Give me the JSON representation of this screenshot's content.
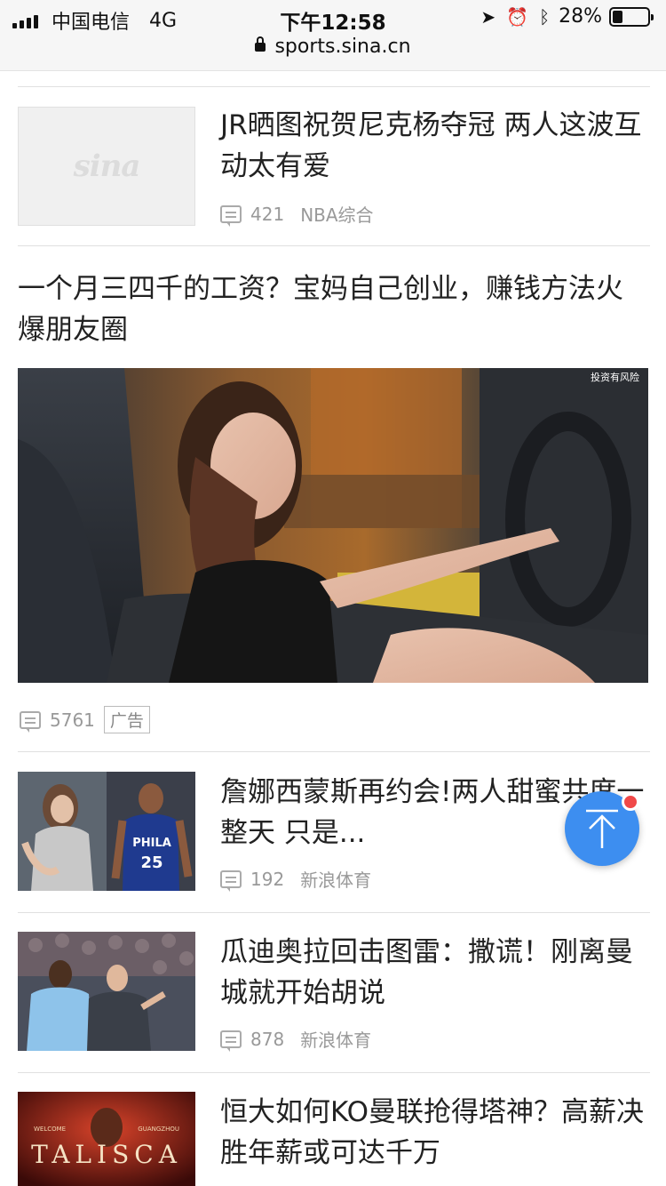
{
  "status_bar": {
    "carrier": "中国电信",
    "network": "4G",
    "time": "下午12:58",
    "battery_text": "28%",
    "battery_level": 0.28
  },
  "url_bar": {
    "domain": "sports.sina.cn"
  },
  "feed": {
    "items": [
      {
        "title": "JR晒图祝贺尼克杨夺冠 两人这波互动太有爱",
        "comments": "421",
        "source": "NBA综合",
        "thumb_logo": "sina"
      },
      {
        "title": "一个月三四千的工资？宝妈自己创业，赚钱方法火爆朋友圈",
        "comments": "5761",
        "badge": "广告",
        "image_caption": "投资有风险"
      },
      {
        "title": "詹娜西蒙斯再约会!两人甜蜜共度一整天 只是...",
        "comments": "192",
        "source": "新浪体育",
        "jersey_text": "PHILA",
        "jersey_number": "25"
      },
      {
        "title": "瓜迪奥拉回击图雷：撒谎！刚离曼城就开始胡说",
        "comments": "878",
        "source": "新浪体育"
      },
      {
        "title": "恒大如何KO曼联抢得塔神？高薪决胜年薪或可达千万",
        "thumb_text_top_left": "WELCOME",
        "thumb_text_top_right": "GUANGZHOU",
        "thumb_text_main": "TALISCA"
      }
    ]
  },
  "colors": {
    "accent": "#3d8ef0",
    "notify_dot": "#f04848",
    "meta_text": "#999999"
  },
  "icons": {
    "back_to_top": "arrow-up-icon",
    "comment": "comment-icon",
    "lock": "lock-icon"
  }
}
